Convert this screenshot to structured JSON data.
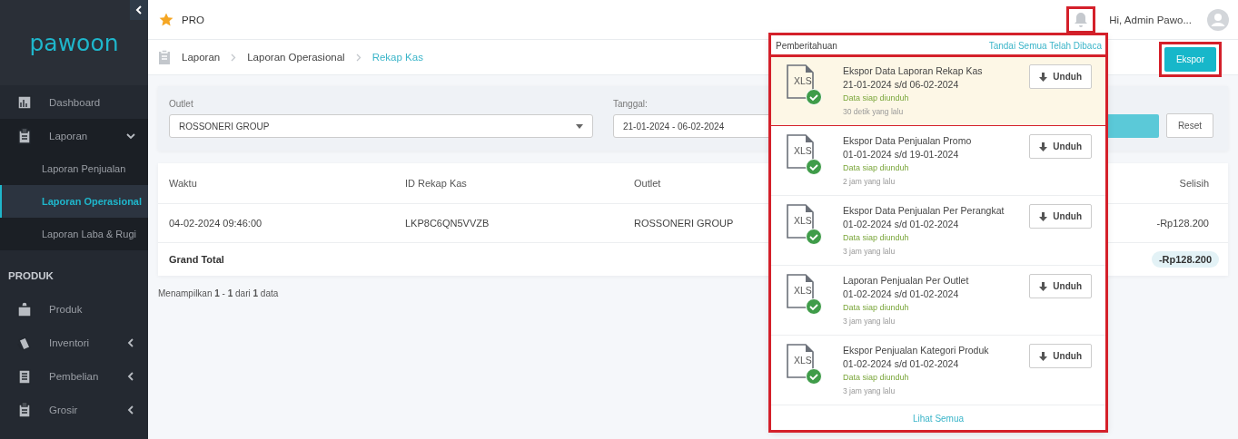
{
  "sidebar": {
    "logo": "pawoon",
    "items": [
      {
        "label": "Dashboard",
        "selected": false
      },
      {
        "label": "Laporan",
        "selected": false,
        "expanded": true,
        "children": [
          {
            "label": "Laporan Penjualan",
            "selected": false
          },
          {
            "label": "Laporan Operasional",
            "selected": true
          },
          {
            "label": "Laporan Laba & Rugi",
            "selected": false
          }
        ]
      }
    ],
    "section": "PRODUK",
    "section_items": [
      {
        "label": "Produk",
        "selected": false
      },
      {
        "label": "Inventori",
        "selected": false,
        "expanded": false
      },
      {
        "label": "Pembelian",
        "selected": false,
        "expanded": false
      },
      {
        "label": "Grosir",
        "selected": false,
        "expanded": false
      }
    ]
  },
  "topbar": {
    "plan": "PRO",
    "greeting": "Hi, Admin Pawo..."
  },
  "breadcrumb": [
    "Laporan",
    "Laporan Operasional",
    "Rekap Kas"
  ],
  "export_button": "Ekspor",
  "filters": {
    "outlet_label": "Outlet",
    "outlet_value": "ROSSONERI GROUP",
    "date_label": "Tanggal:",
    "date_value": "21-01-2024 - 06-02-2024",
    "reset": "Reset"
  },
  "table": {
    "columns": [
      "Waktu",
      "ID Rekap Kas",
      "Outlet",
      "Selisih"
    ],
    "rows": [
      [
        "04-02-2024 09:46:00",
        "LKP8C6QN5VVZB",
        "ROSSONERI GROUP",
        "-Rp128.200"
      ]
    ],
    "total_label": "Grand Total",
    "total_value": "-Rp128.200"
  },
  "pagination": "Menampilkan **1** - **1** dari **1** data",
  "notifications": {
    "title": "Pemberitahuan",
    "mark_all": "Tandai Semua Telah Dibaca",
    "see_all": "Lihat Semua",
    "items": [
      {
        "file": "XLS",
        "title": "Ekspor Data Laporan Rekap Kas",
        "range": "21-01-2024 s/d 06-02-2024",
        "status": "Data siap diunduh",
        "time": "30 detik yang lalu",
        "button": "Unduh",
        "unread": true
      },
      {
        "file": "XLS",
        "title": "Ekspor Data Penjualan Promo",
        "range": "01-01-2024 s/d 19-01-2024",
        "status": "Data siap diunduh",
        "time": "2 jam yang lalu",
        "button": "Unduh",
        "unread": false
      },
      {
        "file": "XLS",
        "title": "Ekspor Data Penjualan Per Perangkat",
        "range": "01-02-2024 s/d 01-02-2024",
        "status": "Data siap diunduh",
        "time": "3 jam yang lalu",
        "button": "Unduh",
        "unread": false
      },
      {
        "file": "XLS",
        "title": "Laporan Penjualan Per Outlet",
        "range": "01-02-2024 s/d 01-02-2024",
        "status": "Data siap diunduh",
        "time": "3 jam yang lalu",
        "button": "Unduh",
        "unread": false
      },
      {
        "file": "XLS",
        "title": "Ekspor Penjualan Kategori Produk",
        "range": "01-02-2024 s/d 01-02-2024",
        "status": "Data siap diunduh",
        "time": "3 jam yang lalu",
        "button": "Unduh",
        "unread": false
      }
    ]
  }
}
